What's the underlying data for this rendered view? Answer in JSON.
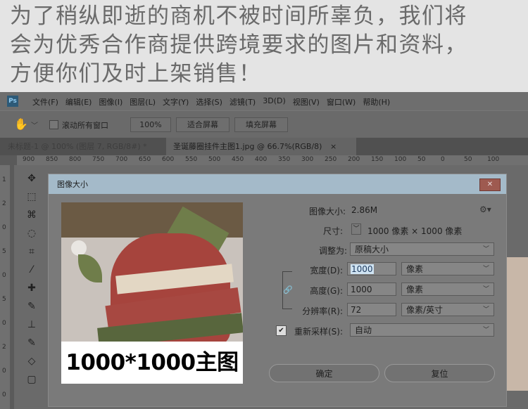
{
  "banner": {
    "lines": [
      "为了稍纵即逝的商机不被时间所辜负，我们将",
      "会为优秀合作商提供跨境要求的图片和资料，",
      "方便你们及时上架销售！"
    ]
  },
  "app": {
    "logo": "Ps",
    "menu": [
      "文件(F)",
      "编辑(E)",
      "图像(I)",
      "图层(L)",
      "文字(Y)",
      "选择(S)",
      "滤镜(T)",
      "3D(D)",
      "视图(V)",
      "窗口(W)",
      "帮助(H)"
    ]
  },
  "options": {
    "scroll_all_label": "滚动所有窗口",
    "zoom": "100%",
    "fit_screen": "适合屏幕",
    "fill_screen": "填充屏幕"
  },
  "tabs": [
    {
      "label": "未标题-1 @ 100% (图层 7, RGB/8#) *"
    },
    {
      "label": "圣诞藤圈挂件主图1.jpg @ 66.7%(RGB/8)"
    }
  ],
  "tab_close": "×",
  "ruler": {
    "ticks": [
      "900",
      "850",
      "800",
      "750",
      "700",
      "650",
      "600",
      "550",
      "500",
      "450",
      "400",
      "350",
      "300",
      "250",
      "200",
      "150",
      "100",
      "50",
      "0",
      "50",
      "100"
    ],
    "vticks": [
      "1",
      "2",
      "0",
      "5",
      "0",
      "5",
      "0",
      "2",
      "0",
      "0"
    ]
  },
  "tools": [
    "✥",
    "⬚",
    "⌘",
    "◌",
    "⌗",
    "⁄",
    "✚",
    "✎",
    "⊥",
    "✎",
    "◇",
    "▢"
  ],
  "dialog": {
    "title": "图像大小",
    "close": "✕",
    "caption": "1000*1000主图",
    "image_size_label": "图像大小:",
    "image_size_value": "2.86M",
    "dimensions_label": "尺寸:",
    "dimensions_value": "1000 像素  ×  1000 像素",
    "fit_label": "调整为:",
    "fit_value": "原稿大小",
    "width_label": "宽度(D):",
    "width_value": "1000",
    "width_unit": "像素",
    "height_label": "高度(G):",
    "height_value": "1000",
    "height_unit": "像素",
    "resolution_label": "分辨率(R):",
    "resolution_value": "72",
    "resolution_unit": "像素/英寸",
    "resample_label": "重新采样(S):",
    "resample_value": "自动",
    "ok": "确定",
    "reset": "复位"
  }
}
